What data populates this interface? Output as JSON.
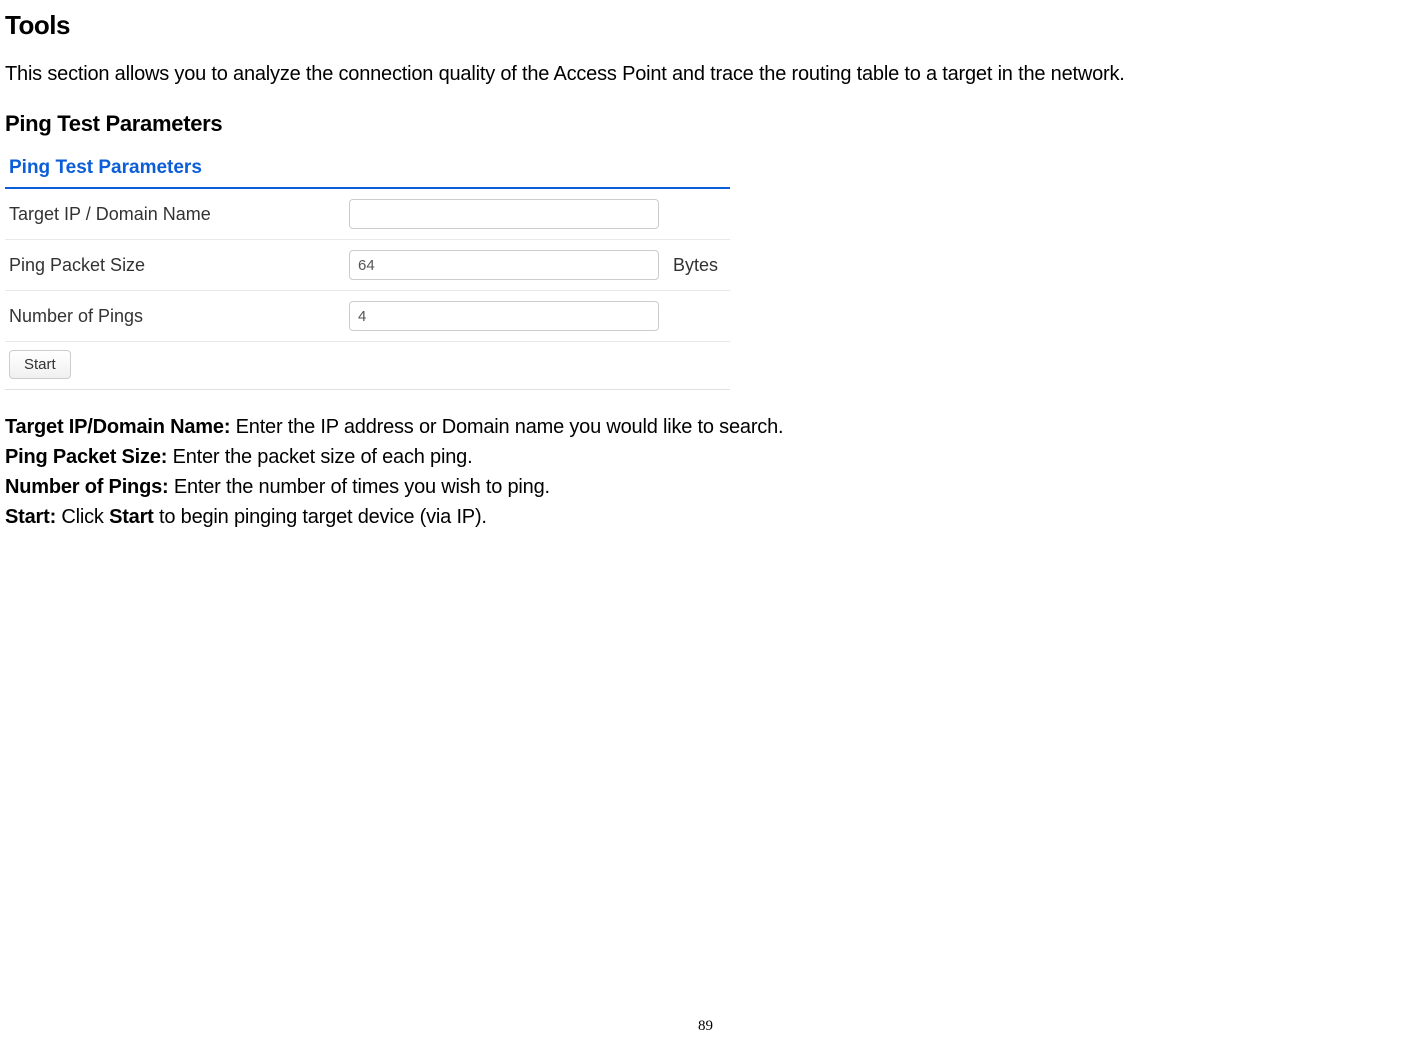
{
  "heading": "Tools",
  "intro": "This section allows you to analyze the connection quality of the Access Point and trace the routing table to a target in the network.",
  "subheading": "Ping Test Parameters",
  "panel": {
    "title": "Ping Test Parameters",
    "rows": {
      "target_ip": {
        "label": "Target IP / Domain Name",
        "value": ""
      },
      "packet_size": {
        "label": "Ping Packet Size",
        "value": "64",
        "unit": "Bytes"
      },
      "num_pings": {
        "label": "Number of Pings",
        "value": "4"
      }
    },
    "start_label": "Start"
  },
  "descriptions": {
    "target_ip": {
      "label": "Target IP/Domain Name:",
      "text": " Enter the IP address or Domain name you would like to search."
    },
    "packet_size": {
      "label": "Ping Packet Size:",
      "text": " Enter the packet size of each ping."
    },
    "num_pings": {
      "label": "Number of Pings:",
      "text": " Enter the number of times you wish to ping."
    },
    "start": {
      "label": "Start:",
      "text_before": " Click ",
      "bold_word": "Start",
      "text_after": " to begin pinging target device (via IP)."
    }
  },
  "page_number": "89"
}
